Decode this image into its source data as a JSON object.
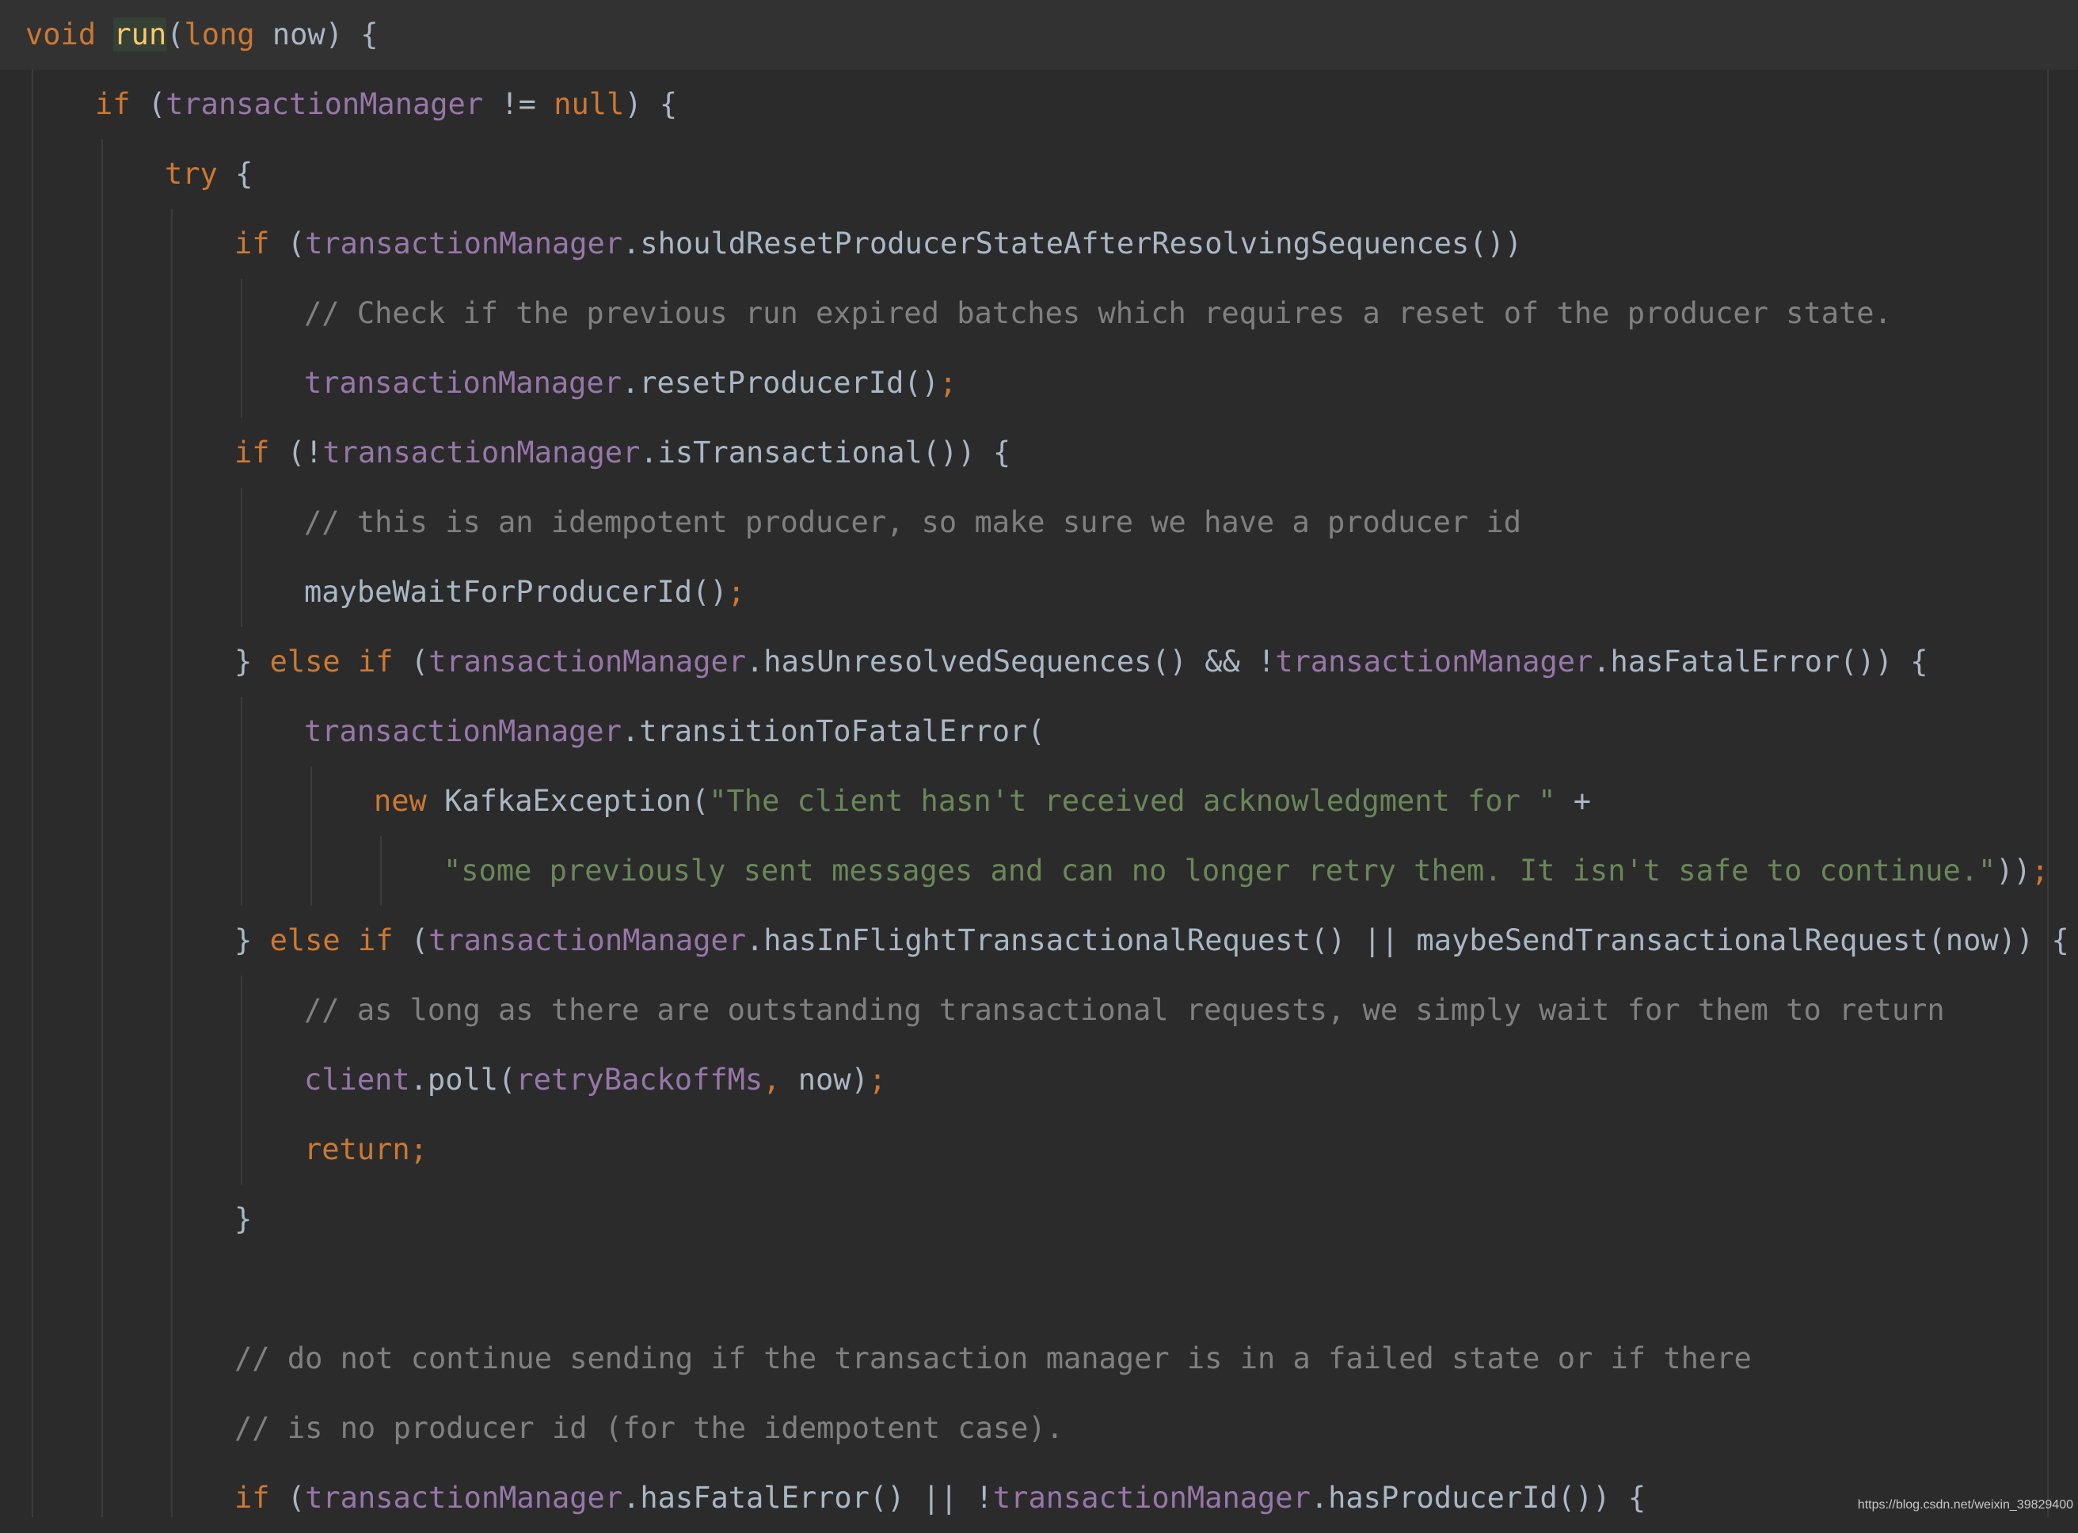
{
  "editor": {
    "colors": {
      "background": "#2b2b2b",
      "keyword": "#cc7832",
      "field": "#9876aa",
      "string": "#6a8759",
      "comment": "#808080",
      "method_declaration": "#ffc66d",
      "default_text": "#a9b7c6",
      "current_line": "#323232",
      "identifier_highlight": "#344134"
    },
    "lines": [
      {
        "indent": 0,
        "tokens": [
          {
            "t": "void",
            "c": "kw"
          },
          {
            "t": " ",
            "c": "plain"
          },
          {
            "t": "run",
            "c": "fn",
            "hl": true
          },
          {
            "t": "(",
            "c": "plain"
          },
          {
            "t": "long",
            "c": "kw"
          },
          {
            "t": " now) {",
            "c": "plain"
          }
        ]
      },
      {
        "indent": 1,
        "tokens": [
          {
            "t": "if",
            "c": "kw"
          },
          {
            "t": " (",
            "c": "plain"
          },
          {
            "t": "transactionManager",
            "c": "fld"
          },
          {
            "t": " != ",
            "c": "plain"
          },
          {
            "t": "null",
            "c": "kw"
          },
          {
            "t": ") {",
            "c": "plain"
          }
        ]
      },
      {
        "indent": 2,
        "tokens": [
          {
            "t": "try",
            "c": "kw"
          },
          {
            "t": " {",
            "c": "plain"
          }
        ]
      },
      {
        "indent": 3,
        "tokens": [
          {
            "t": "if",
            "c": "kw"
          },
          {
            "t": " (",
            "c": "plain"
          },
          {
            "t": "transactionManager",
            "c": "fld"
          },
          {
            "t": ".shouldResetProducerStateAfterResolvingSequences())",
            "c": "plain"
          }
        ]
      },
      {
        "indent": 4,
        "tokens": [
          {
            "t": "// Check if the previous run expired batches which requires a reset of the producer state.",
            "c": "cmt"
          }
        ]
      },
      {
        "indent": 4,
        "tokens": [
          {
            "t": "transactionManager",
            "c": "fld"
          },
          {
            "t": ".resetProducerId()",
            "c": "plain"
          },
          {
            "t": ";",
            "c": "kw"
          }
        ]
      },
      {
        "indent": 3,
        "tokens": [
          {
            "t": "if",
            "c": "kw"
          },
          {
            "t": " (!",
            "c": "plain"
          },
          {
            "t": "transactionManager",
            "c": "fld"
          },
          {
            "t": ".isTransactional()) {",
            "c": "plain"
          }
        ]
      },
      {
        "indent": 4,
        "tokens": [
          {
            "t": "// this is an idempotent producer, so make sure we have a producer id",
            "c": "cmt"
          }
        ]
      },
      {
        "indent": 4,
        "tokens": [
          {
            "t": "maybeWaitForProducerId()",
            "c": "plain"
          },
          {
            "t": ";",
            "c": "kw"
          }
        ]
      },
      {
        "indent": 3,
        "tokens": [
          {
            "t": "} ",
            "c": "plain"
          },
          {
            "t": "else if",
            "c": "kw"
          },
          {
            "t": " (",
            "c": "plain"
          },
          {
            "t": "transactionManager",
            "c": "fld"
          },
          {
            "t": ".hasUnresolvedSequences() && !",
            "c": "plain"
          },
          {
            "t": "transactionManager",
            "c": "fld"
          },
          {
            "t": ".hasFatalError()) {",
            "c": "plain"
          }
        ]
      },
      {
        "indent": 4,
        "tokens": [
          {
            "t": "transactionManager",
            "c": "fld"
          },
          {
            "t": ".transitionToFatalError(",
            "c": "plain"
          }
        ]
      },
      {
        "indent": 5,
        "tokens": [
          {
            "t": "new",
            "c": "kw"
          },
          {
            "t": " KafkaException(",
            "c": "plain"
          },
          {
            "t": "\"The client hasn't received acknowledgment for \"",
            "c": "str"
          },
          {
            "t": " +",
            "c": "plain"
          }
        ]
      },
      {
        "indent": 6,
        "tokens": [
          {
            "t": "\"some previously sent messages and can no longer retry them. It isn't safe to continue.\"",
            "c": "str"
          },
          {
            "t": "))",
            "c": "plain"
          },
          {
            "t": ";",
            "c": "kw"
          }
        ]
      },
      {
        "indent": 3,
        "tokens": [
          {
            "t": "} ",
            "c": "plain"
          },
          {
            "t": "else if",
            "c": "kw"
          },
          {
            "t": " (",
            "c": "plain"
          },
          {
            "t": "transactionManager",
            "c": "fld"
          },
          {
            "t": ".hasInFlightTransactionalRequest() || maybeSendTransactionalRequest(now)) {",
            "c": "plain"
          }
        ]
      },
      {
        "indent": 4,
        "tokens": [
          {
            "t": "// as long as there are outstanding transactional requests, we simply wait for them to return",
            "c": "cmt"
          }
        ]
      },
      {
        "indent": 4,
        "tokens": [
          {
            "t": "client",
            "c": "fld"
          },
          {
            "t": ".poll(",
            "c": "plain"
          },
          {
            "t": "retryBackoffMs",
            "c": "fld"
          },
          {
            "t": ",",
            "c": "kw"
          },
          {
            "t": " now)",
            "c": "plain"
          },
          {
            "t": ";",
            "c": "kw"
          }
        ]
      },
      {
        "indent": 4,
        "tokens": [
          {
            "t": "return;",
            "c": "kw"
          }
        ]
      },
      {
        "indent": 3,
        "tokens": [
          {
            "t": "}",
            "c": "plain"
          }
        ]
      },
      {
        "indent": 3,
        "tokens": []
      },
      {
        "indent": 3,
        "tokens": [
          {
            "t": "// do not continue sending if the transaction manager is in a failed state or if there",
            "c": "cmt"
          }
        ]
      },
      {
        "indent": 3,
        "tokens": [
          {
            "t": "// is no producer id (for the idempotent case).",
            "c": "cmt"
          }
        ]
      },
      {
        "indent": 3,
        "tokens": [
          {
            "t": "if",
            "c": "kw"
          },
          {
            "t": " (",
            "c": "plain"
          },
          {
            "t": "transactionManager",
            "c": "fld"
          },
          {
            "t": ".hasFatalError() || !",
            "c": "plain"
          },
          {
            "t": "transactionManager",
            "c": "fld"
          },
          {
            "t": ".hasProducerId()) {",
            "c": "plain"
          }
        ]
      }
    ]
  },
  "watermark": "https://blog.csdn.net/weixin_39829400"
}
